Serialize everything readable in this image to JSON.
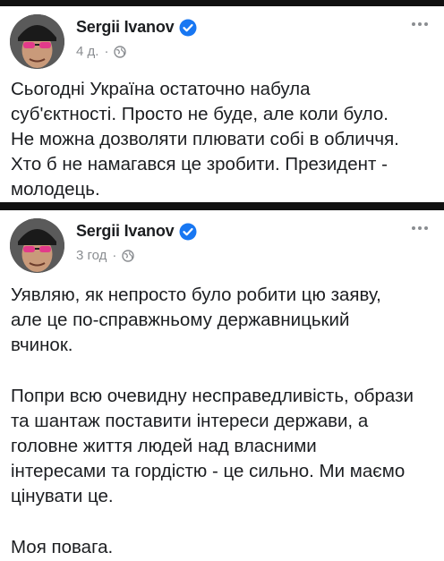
{
  "posts": [
    {
      "author": "Sergii Ivanov",
      "time": "4 д.",
      "separator": "·",
      "paragraphs": [
        [
          "Сьогодні Україна остаточно набула",
          "суб'єктності. Просто не буде, але коли було.",
          "Не можна дозволяти плювати собі в обличчя.",
          "Хто б не намагався це зробити. Президент -",
          "молодець."
        ]
      ]
    },
    {
      "author": "Sergii Ivanov",
      "time": "3 год",
      "separator": "·",
      "paragraphs": [
        [
          "Уявляю, як непросто було робити цю заяву,",
          "але це по-справжньому державницький",
          "вчинок."
        ],
        [
          "Попри всю очевидну несправедливість, образи",
          "та шантаж поставити інтереси держави, а",
          "головне життя людей над власними",
          "інтересами та гордістю - це сильно. Ми маємо",
          "цінувати це."
        ],
        [
          "Моя повага."
        ]
      ]
    }
  ],
  "icons": {
    "verified": "verified-badge-icon",
    "audience": "globe-icon",
    "menu": "more-options-icon"
  },
  "colors": {
    "verified": "#1877f2",
    "meta": "#8a8d91",
    "text": "#1c1e21"
  }
}
